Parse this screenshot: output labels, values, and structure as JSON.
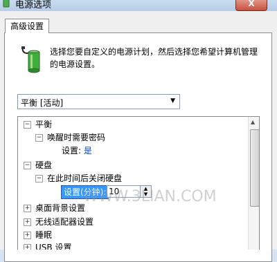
{
  "window": {
    "title": "电源选项",
    "close_symbol": "X"
  },
  "tab": {
    "label": "高级设置"
  },
  "description": "选择您要自定义的电源计划，然后选择您希望计算机管理的电源设置。",
  "plan_dropdown": {
    "selected": "平衡 [活动]"
  },
  "tree": {
    "items": [
      {
        "expander": "⊟",
        "label": "平衡"
      },
      {
        "expander": "⊟",
        "label": "唤醒时需要密码"
      },
      {
        "label": "设置:",
        "value": "是"
      },
      {
        "expander": "⊟",
        "label": "硬盘"
      },
      {
        "expander": "⊟",
        "label": "在此时间后关闭硬盘"
      },
      {
        "expander": "⊞",
        "label": "桌面背景设置"
      },
      {
        "expander": "⊞",
        "label": "无线适配器设置"
      },
      {
        "expander": "⊞",
        "label": "睡眠"
      },
      {
        "expander": "⊞",
        "label": "USB 设置"
      }
    ],
    "setting_label": "设置(分钟):",
    "setting_value": "10"
  },
  "watermark": "WWW.3LIAN.COM",
  "colors": {
    "selection": "#3399ff",
    "value_link": "#0044cc",
    "close": "#c8513f"
  }
}
